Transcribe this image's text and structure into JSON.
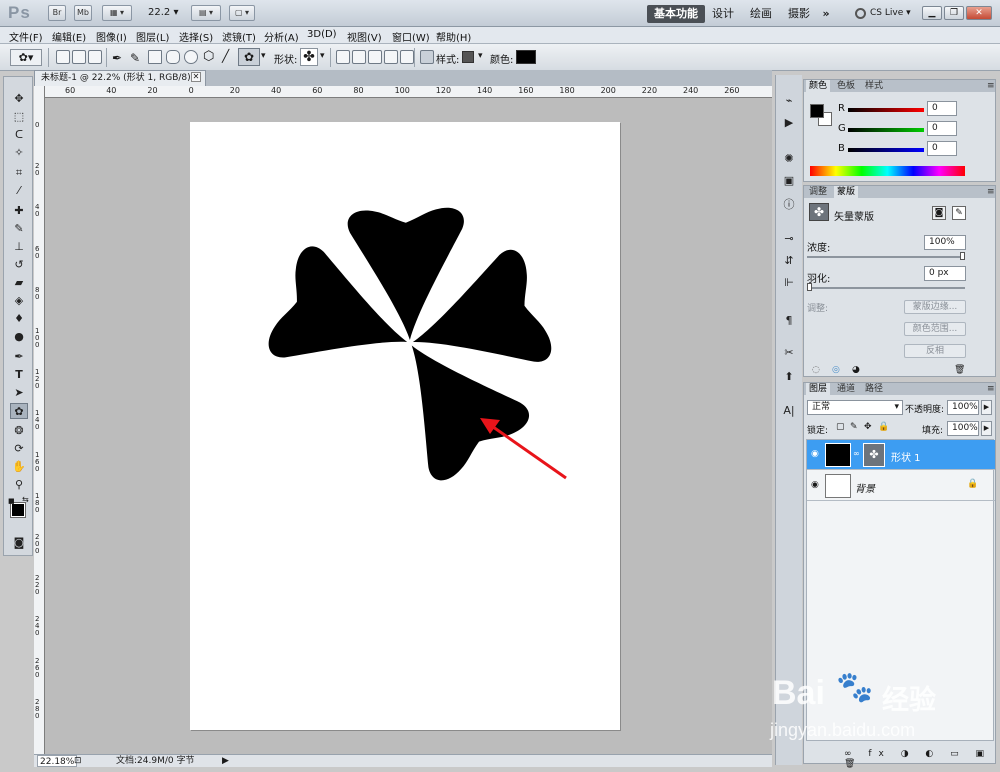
{
  "appbar": {
    "logo": "Ps",
    "bridge": "Br",
    "minibridge": "Mb",
    "zoom_value": "22.2",
    "workspaces": [
      "基本功能",
      "设计",
      "绘画",
      "摄影"
    ],
    "more": "»",
    "cslive": "CS Live"
  },
  "menu": [
    "文件(F)",
    "编辑(E)",
    "图像(I)",
    "图层(L)",
    "选择(S)",
    "滤镜(T)",
    "分析(A)",
    "3D(D)",
    "视图(V)",
    "窗口(W)",
    "帮助(H)"
  ],
  "options": {
    "shape_label": "形状:",
    "style_label": "样式:",
    "color_label": "颜色:",
    "color_value": "#000000"
  },
  "document": {
    "tab_title": "未标题-1 @ 22.2% (形状 1, RGB/8) *",
    "ruler_top": [
      "60",
      "40",
      "20",
      "0",
      "20",
      "40",
      "60",
      "80",
      "100",
      "120",
      "140",
      "160",
      "180",
      "200",
      "220",
      "240",
      "260"
    ],
    "ruler_left": [
      "0",
      "2 0",
      "4 0",
      "6 0",
      "8 0",
      "1 0 0",
      "1 2 0",
      "1 4 0",
      "1 6 0",
      "1 8 0",
      "2 0 0",
      "2 2 0",
      "2 4 0",
      "2 6 0",
      "2 8 0"
    ],
    "shape_color": "#000000",
    "arrow_color": "#e8141a"
  },
  "status": {
    "zoom": "22.18%",
    "doc_info": "文档:24.9M/0 字节"
  },
  "color_panel": {
    "tabs": [
      "颜色",
      "色板",
      "样式"
    ],
    "channels": [
      {
        "label": "R",
        "value": "0"
      },
      {
        "label": "G",
        "value": "0"
      },
      {
        "label": "B",
        "value": "0"
      }
    ]
  },
  "mask_panel": {
    "tabs": [
      "调整",
      "蒙版"
    ],
    "title": "矢量蒙版",
    "density_label": "浓度:",
    "density_value": "100%",
    "feather_label": "羽化:",
    "feather_value": "0 px",
    "refine_label": "调整:",
    "btn_mask_edge": "蒙版边缘...",
    "btn_color_range": "颜色范围...",
    "btn_invert": "反相"
  },
  "layers_panel": {
    "tabs": [
      "图层",
      "通道",
      "路径"
    ],
    "blend_mode": "正常",
    "opacity_label": "不透明度:",
    "opacity_value": "100%",
    "lock_label": "锁定:",
    "fill_label": "填充:",
    "fill_value": "100%",
    "layers": [
      {
        "name": "形状 1",
        "selected": true
      },
      {
        "name": "背景",
        "selected": false
      }
    ]
  },
  "watermark": {
    "brand": "Bai",
    "brand_cn": "经验",
    "url": "jingyan.baidu.com"
  }
}
